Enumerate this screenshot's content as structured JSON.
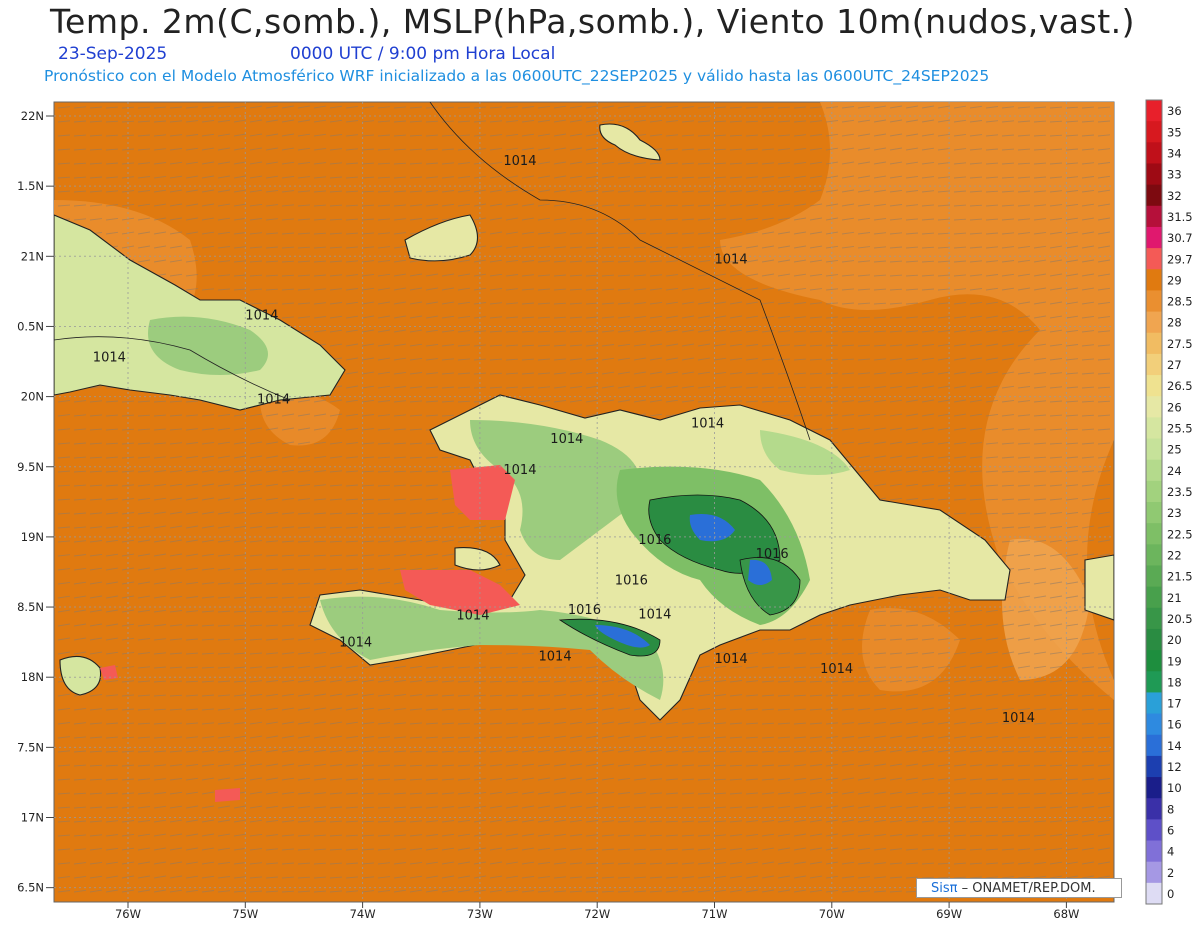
{
  "header": {
    "title": "Temp. 2m(C,somb.), MSLP(hPa,somb.), Viento 10m(nudos,vast.)",
    "date": "23-Sep-2025",
    "time": "0000 UTC / 9:00 pm Hora Local",
    "model_line": "Pronóstico con el Modelo Atmosférico WRF inicializado a las 0600UTC_22SEP2025 y válido hasta las  0600UTC_24SEP2025"
  },
  "credit": {
    "brand": "Sisπ",
    "org": "– ONAMET/REP.DOM."
  },
  "axes": {
    "lat_labels": [
      "22N",
      "1.5N",
      "21N",
      "0.5N",
      "20N",
      "9.5N",
      "19N",
      "8.5N",
      "18N",
      "7.5N",
      "17N",
      "6.5N"
    ],
    "lon_labels": [
      "76W",
      "75W",
      "74W",
      "73W",
      "72W",
      "71W",
      "70W",
      "69W",
      "68W"
    ]
  },
  "isobars": [
    {
      "label": "1014",
      "lat": 21.65,
      "lon": -72.8
    },
    {
      "label": "1014",
      "lat": 20.95,
      "lon": -71.0
    },
    {
      "label": "1014",
      "lat": 20.55,
      "lon": -75.0
    },
    {
      "label": "1014",
      "lat": 20.25,
      "lon": -76.3
    },
    {
      "label": "1014",
      "lat": 19.95,
      "lon": -74.9
    },
    {
      "label": "1014",
      "lat": 19.67,
      "lon": -72.4
    },
    {
      "label": "1014",
      "lat": 19.78,
      "lon": -71.2
    },
    {
      "label": "1014",
      "lat": 19.45,
      "lon": -72.8
    },
    {
      "label": "1016",
      "lat": 18.95,
      "lon": -71.65
    },
    {
      "label": "1016",
      "lat": 18.85,
      "lon": -70.65
    },
    {
      "label": "1016",
      "lat": 18.66,
      "lon": -71.85
    },
    {
      "label": "1016",
      "lat": 18.45,
      "lon": -72.25
    },
    {
      "label": "1014",
      "lat": 18.42,
      "lon": -71.65
    },
    {
      "label": "1014",
      "lat": 18.41,
      "lon": -73.2
    },
    {
      "label": "1014",
      "lat": 18.22,
      "lon": -74.2
    },
    {
      "label": "1014",
      "lat": 18.12,
      "lon": -72.5
    },
    {
      "label": "1014",
      "lat": 18.1,
      "lon": -71.0
    },
    {
      "label": "1014",
      "lat": 18.03,
      "lon": -70.1
    },
    {
      "label": "1014",
      "lat": 17.68,
      "lon": -68.55
    }
  ],
  "legend": {
    "labels": [
      "36",
      "35",
      "34",
      "33",
      "32",
      "31.5",
      "30.7",
      "29.7",
      "29",
      "28.5",
      "28",
      "27.5",
      "27",
      "26.5",
      "26",
      "25.5",
      "25",
      "24",
      "23.5",
      "23",
      "22.5",
      "22",
      "21.5",
      "21",
      "20.5",
      "20",
      "19",
      "18",
      "17",
      "16",
      "14",
      "12",
      "10",
      "8",
      "6",
      "4",
      "2",
      "0"
    ],
    "colors": [
      "#e8202b",
      "#d7191f",
      "#c0101a",
      "#9e0a14",
      "#7d0a10",
      "#b5103a",
      "#e0186e",
      "#f45a56",
      "#e07a10",
      "#ea8f30",
      "#f0a550",
      "#f1bc62",
      "#f2cf7a",
      "#efe290",
      "#e6e8a5",
      "#d5e6a0",
      "#c6e29a",
      "#b4da8c",
      "#a2d27e",
      "#90c972",
      "#7ebf66",
      "#6cb55d",
      "#5aaa54",
      "#48a04c",
      "#389648",
      "#2a8c42",
      "#1e8e3e",
      "#1f9a55",
      "#2aa0d8",
      "#2e8ae0",
      "#2a6fd8",
      "#1c3fb0",
      "#1a1e8a",
      "#3a30a8",
      "#5e50c8",
      "#8070d8",
      "#a598e4",
      "#dedcf4"
    ]
  },
  "colors": {
    "sea": "#e07a10",
    "land_hi": "#e6e8a5",
    "land_mid": "#9ccc7e",
    "mountain": "#2a8c42",
    "cold": "#2a6fd8",
    "warm_spot": "#f45a56"
  }
}
